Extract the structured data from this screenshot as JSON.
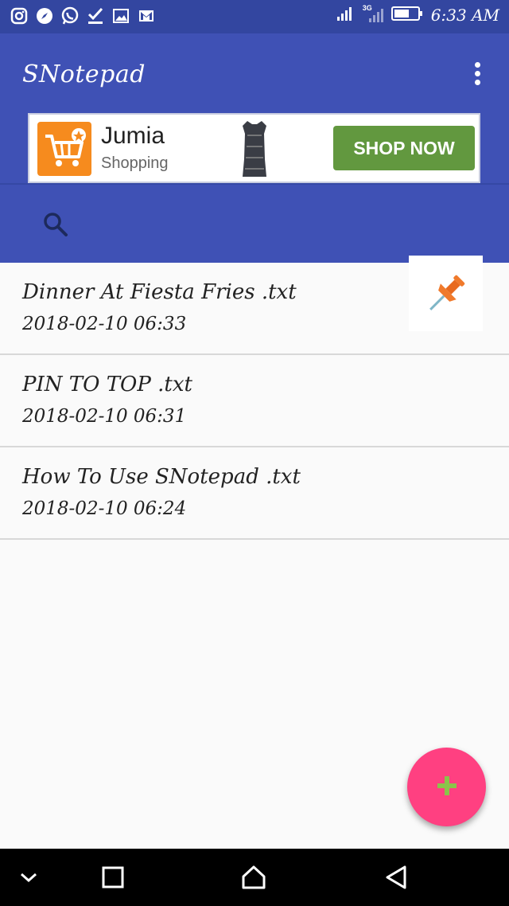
{
  "status_bar": {
    "time": "6:33 AM",
    "network_label": "3G",
    "notification_icons": [
      "instagram-icon",
      "compass-icon",
      "whatsapp-icon",
      "checkmark-icon",
      "image-icon",
      "gmail-icon"
    ],
    "battery_level": 0.6
  },
  "app_bar": {
    "title": "SNotepad",
    "menu_icon": "more-vert-icon",
    "search_icon": "search-icon"
  },
  "ad": {
    "brand": "Jumia",
    "subtitle": "Shopping",
    "cta": "SHOP NOW",
    "logo_icon": "shopping-cart-icon",
    "product_icon": "dress-icon"
  },
  "notes": [
    {
      "title": "Dinner At Fiesta Fries .txt",
      "date": "2018-02-10 06:33",
      "pinned": true
    },
    {
      "title": "PIN TO TOP .txt",
      "date": "2018-02-10 06:31",
      "pinned": false
    },
    {
      "title": "How To Use SNotepad .txt",
      "date": "2018-02-10 06:24",
      "pinned": false
    }
  ],
  "fab_icon": "plus-icon",
  "nav_bar": {
    "icons": [
      "chevron-down-icon",
      "recent-apps-icon",
      "home-icon",
      "back-icon"
    ]
  },
  "colors": {
    "primary": "#3f51b5",
    "status_bar": "#3346a0",
    "accent": "#ff4081",
    "ad_cta": "#62983f",
    "pin": "#f07a2c"
  }
}
